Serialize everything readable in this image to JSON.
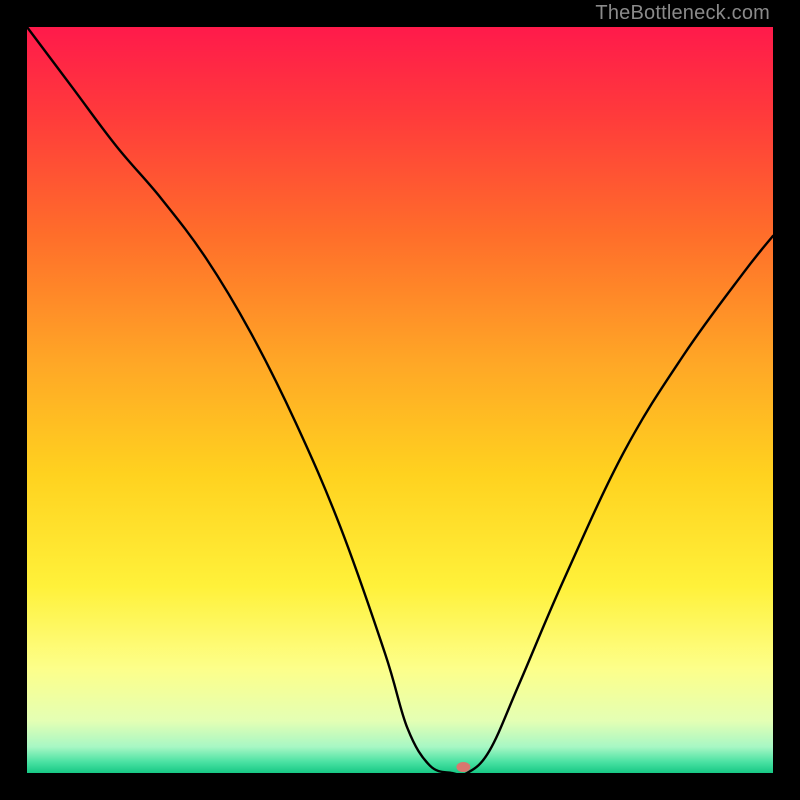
{
  "watermark": "TheBottleneck.com",
  "chart_data": {
    "type": "line",
    "title": "",
    "xlabel": "",
    "ylabel": "",
    "xlim": [
      0,
      100
    ],
    "ylim": [
      0,
      100
    ],
    "legend": false,
    "grid": false,
    "background": {
      "type": "vertical-gradient",
      "stops": [
        {
          "pos": 0.0,
          "color": "#ff1a4b"
        },
        {
          "pos": 0.12,
          "color": "#ff3b3b"
        },
        {
          "pos": 0.28,
          "color": "#ff6e2a"
        },
        {
          "pos": 0.45,
          "color": "#ffa726"
        },
        {
          "pos": 0.6,
          "color": "#ffd21f"
        },
        {
          "pos": 0.75,
          "color": "#fff13a"
        },
        {
          "pos": 0.86,
          "color": "#fdff8a"
        },
        {
          "pos": 0.93,
          "color": "#e4ffb4"
        },
        {
          "pos": 0.965,
          "color": "#a7f7c4"
        },
        {
          "pos": 0.985,
          "color": "#4be2a3"
        },
        {
          "pos": 1.0,
          "color": "#17c885"
        }
      ]
    },
    "series": [
      {
        "name": "bottleneck-curve",
        "x": [
          0,
          6,
          12,
          18,
          24,
          30,
          36,
          42,
          48,
          51,
          54,
          57,
          59,
          62,
          66,
          72,
          80,
          88,
          96,
          100
        ],
        "y": [
          100,
          92,
          84,
          77,
          69,
          59,
          47,
          33,
          16,
          6,
          1,
          0,
          0,
          3,
          12,
          26,
          43,
          56,
          67,
          72
        ]
      }
    ],
    "marker": {
      "x": 58.5,
      "y": 0.8,
      "color": "#d9776f",
      "rx": 7,
      "ry": 5
    },
    "flat_bottom": {
      "x_start": 54,
      "x_end": 59,
      "y": 0
    }
  }
}
